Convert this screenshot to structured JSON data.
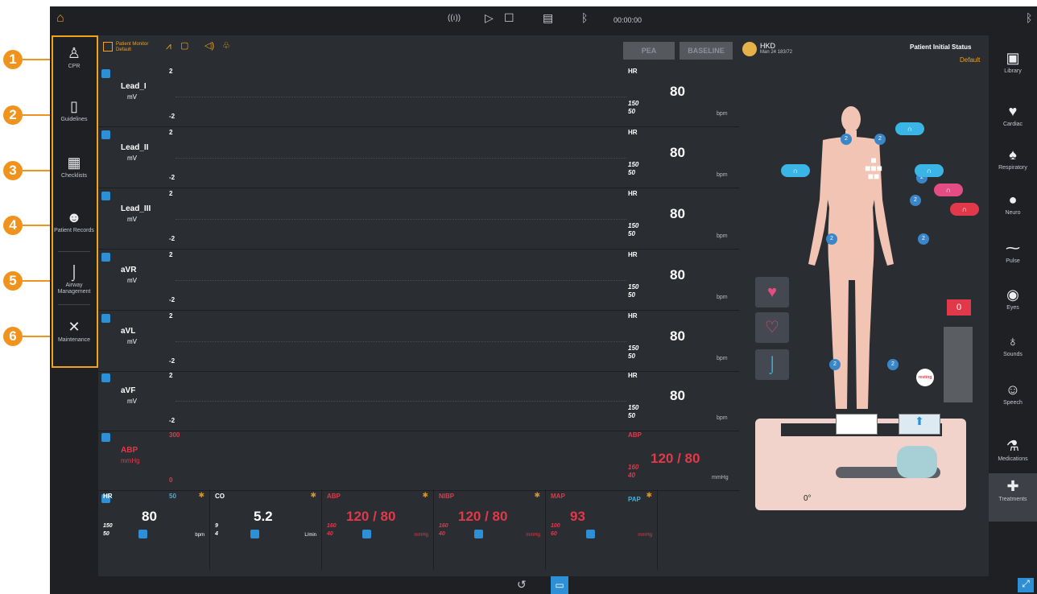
{
  "callouts": [
    "1",
    "2",
    "3",
    "4",
    "5",
    "6"
  ],
  "topbar": {
    "timer": "00:00:00",
    "icons": [
      "home-icon",
      "broadcast-icon",
      "play-icon",
      "stop-icon",
      "save-icon",
      "bluetooth-icon"
    ]
  },
  "left_nav": [
    {
      "label": "CPR",
      "icon": "cpr-icon"
    },
    {
      "label": "Guidelines",
      "icon": "guidelines-icon"
    },
    {
      "label": "Checklists",
      "icon": "checklist-icon"
    },
    {
      "label": "Patient Records",
      "icon": "patient-icon"
    },
    {
      "label": "Airway Management",
      "icon": "airway-icon"
    },
    {
      "label": "Maintenance",
      "icon": "wrench-icon"
    }
  ],
  "right_nav": [
    {
      "label": "Library"
    },
    {
      "label": "Cardiac"
    },
    {
      "label": "Respiratory"
    },
    {
      "label": "Neuro"
    },
    {
      "label": "Pulse"
    },
    {
      "label": "Eyes"
    },
    {
      "label": "Sounds"
    },
    {
      "label": "Speech"
    },
    {
      "label": "Medications"
    },
    {
      "label": "Treatments"
    }
  ],
  "monitor_header": {
    "title": "Patient Monitor",
    "subtitle": "Default",
    "pea": "PEA",
    "baseline": "BASELINE"
  },
  "patient": {
    "name": "HKD",
    "info": "Man 24 183/72",
    "status_title": "Patient Initial Status",
    "status_value": "Default"
  },
  "leads": [
    {
      "name": "Lead_I",
      "unit": "mV",
      "ymax": "2",
      "ymin": "-2",
      "hr_label": "HR",
      "hr": "80",
      "hi": "150",
      "lo": "50",
      "unit_hr": "bpm"
    },
    {
      "name": "Lead_II",
      "unit": "mV",
      "ymax": "2",
      "ymin": "-2",
      "hr_label": "HR",
      "hr": "80",
      "hi": "150",
      "lo": "50",
      "unit_hr": "bpm"
    },
    {
      "name": "Lead_III",
      "unit": "mV",
      "ymax": "2",
      "ymin": "-2",
      "hr_label": "HR",
      "hr": "80",
      "hi": "150",
      "lo": "50",
      "unit_hr": "bpm"
    },
    {
      "name": "aVR",
      "unit": "mV",
      "ymax": "2",
      "ymin": "-2",
      "hr_label": "HR",
      "hr": "80",
      "hi": "150",
      "lo": "50",
      "unit_hr": "bpm"
    },
    {
      "name": "aVL",
      "unit": "mV",
      "ymax": "2",
      "ymin": "-2",
      "hr_label": "HR",
      "hr": "80",
      "hi": "150",
      "lo": "50",
      "unit_hr": "bpm"
    },
    {
      "name": "aVF",
      "unit": "mV",
      "ymax": "2",
      "ymin": "-2",
      "hr_label": "HR",
      "hr": "80",
      "hi": "150",
      "lo": "50",
      "unit_hr": "bpm"
    }
  ],
  "abp": {
    "name": "ABP",
    "unit": "mmHg",
    "ymax": "300",
    "ymin": "0",
    "label": "ABP",
    "value": "120 / 80",
    "hi": "160",
    "lo": "40"
  },
  "pap": {
    "ymax": "50",
    "label": "PAP"
  },
  "vitals": [
    {
      "label": "HR",
      "value": "80",
      "hi": "150",
      "lo": "50",
      "unit": "bpm"
    },
    {
      "label": "CO",
      "value": "5.2",
      "hi": "9",
      "lo": "4",
      "unit": "L/min"
    },
    {
      "label": "ABP",
      "value": "120 / 80",
      "hi": "160",
      "lo": "40",
      "unit": "mmHg"
    },
    {
      "label": "NIBP",
      "value": "120 / 80",
      "hi": "160",
      "lo": "40",
      "unit": "mmHg"
    },
    {
      "label": "MAP",
      "value": "93",
      "hi": "100",
      "lo": "60",
      "unit": "mmHg"
    }
  ],
  "body": {
    "bar_value": "0",
    "tag": "resting",
    "angle": "0°"
  },
  "colors": {
    "accent_orange": "#f0931e",
    "alarm_red": "#e2394a",
    "cyan": "#3ab5e6",
    "pink": "#e44d84"
  }
}
